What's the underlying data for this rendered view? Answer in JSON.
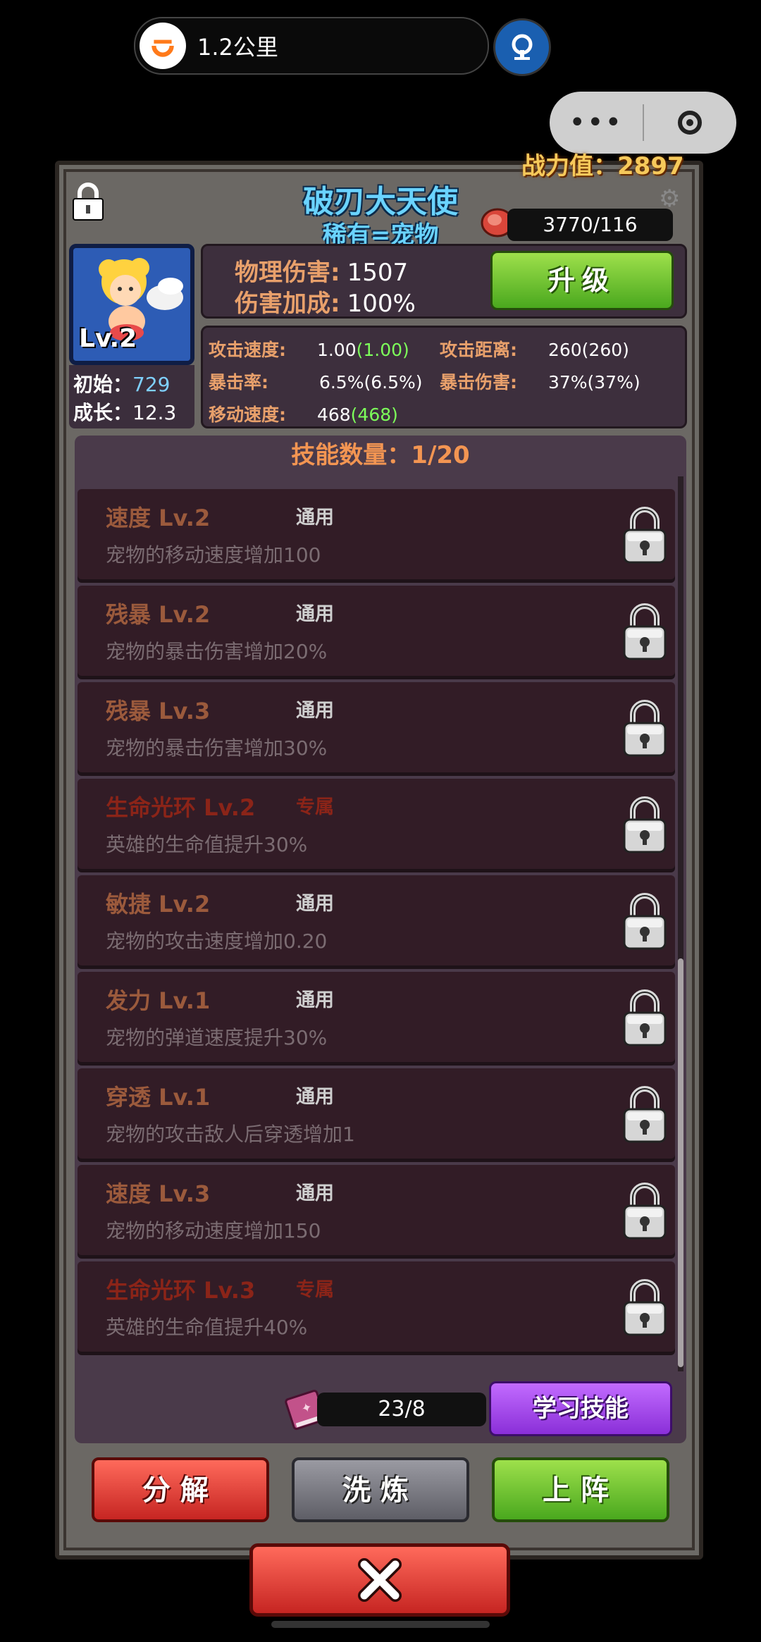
{
  "nav": {
    "distance": "1.2公里",
    "logo_icon": "didi-icon",
    "rail_icon": "china-railway-icon"
  },
  "capsule": {
    "more_icon": "more-dots-icon",
    "close_icon": "target-icon"
  },
  "power": {
    "label": "战力值：2897"
  },
  "pet": {
    "name": "破刃大天使",
    "rarity": "稀有=宠物",
    "level": "Lv.2",
    "initial_label": "初始：",
    "initial_value": "729",
    "growth_label": "成长：",
    "growth_value": "12.3",
    "food": "3770/116"
  },
  "damage": {
    "phys_label": "物理伤害:",
    "phys_value": "1507",
    "bonus_label": "伤害加成:",
    "bonus_value": "100%",
    "upgrade_label": "升级"
  },
  "attrs": {
    "atk_speed_label": "攻击速度:",
    "atk_speed_value": "1.00",
    "atk_speed_base": "(1.00)",
    "range_label": "攻击距离:",
    "range_value": "260(260)",
    "crit_label": "暴击率:",
    "crit_value": "6.5%(6.5%)",
    "crit_dmg_label": "暴击伤害:",
    "crit_dmg_value": "37%(37%)",
    "move_label": "移动速度:",
    "move_value": "468",
    "move_base": "(468)"
  },
  "skills": {
    "header": "技能数量：1/20",
    "items": [
      {
        "name": "速度 Lv.2",
        "tag": "通用",
        "desc": "宠物的移动速度增加100",
        "exclusive": false
      },
      {
        "name": "残暴 Lv.2",
        "tag": "通用",
        "desc": "宠物的暴击伤害增加20%",
        "exclusive": false
      },
      {
        "name": "残暴 Lv.3",
        "tag": "通用",
        "desc": "宠物的暴击伤害增加30%",
        "exclusive": false
      },
      {
        "name": "生命光环 Lv.2",
        "tag": "专属",
        "desc": "英雄的生命值提升30%",
        "exclusive": true
      },
      {
        "name": "敏捷 Lv.2",
        "tag": "通用",
        "desc": "宠物的攻击速度增加0.20",
        "exclusive": false
      },
      {
        "name": "发力 Lv.1",
        "tag": "通用",
        "desc": "宠物的弹道速度提升30%",
        "exclusive": false
      },
      {
        "name": "穿透 Lv.1",
        "tag": "通用",
        "desc": "宠物的攻击敌人后穿透增加1",
        "exclusive": false
      },
      {
        "name": "速度 Lv.3",
        "tag": "通用",
        "desc": "宠物的移动速度增加150",
        "exclusive": false
      },
      {
        "name": "生命光环 Lv.3",
        "tag": "专属",
        "desc": "英雄的生命值提升40%",
        "exclusive": true
      }
    ]
  },
  "book": {
    "count": "23/8",
    "learn_label": "学习技能"
  },
  "actions": {
    "decompose": "分解",
    "refine": "洗炼",
    "deploy": "上阵"
  },
  "colors": {
    "name_blue": "#6ad3ff",
    "skill_name": "#9b5a3c",
    "exclusive": "#8b2418",
    "power_gold": "#f6c95b"
  }
}
